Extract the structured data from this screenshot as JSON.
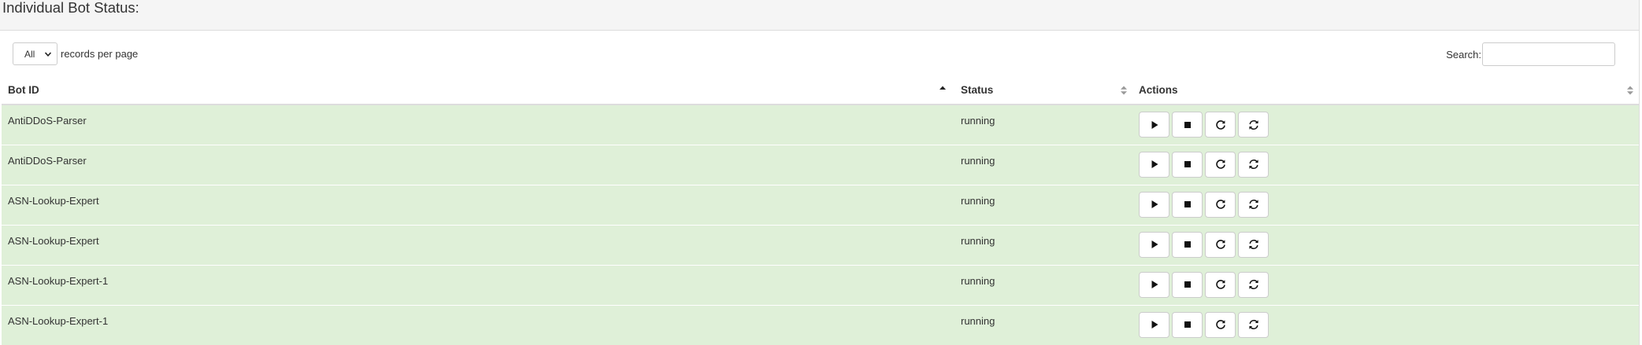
{
  "panel": {
    "title": "Individual Bot Status:"
  },
  "controls": {
    "length_value": "All",
    "length_label": "records per page",
    "search_label": "Search:",
    "search_value": ""
  },
  "table": {
    "columns": [
      "Bot ID",
      "Status",
      "Actions"
    ],
    "sorted_column": "Bot ID",
    "sort_direction": "ascending",
    "row_color": "#dff0d8",
    "rows": [
      {
        "bot_id": "AntiDDoS-Parser",
        "status": "running"
      },
      {
        "bot_id": "AntiDDoS-Parser",
        "status": "running"
      },
      {
        "bot_id": "ASN-Lookup-Expert",
        "status": "running"
      },
      {
        "bot_id": "ASN-Lookup-Expert",
        "status": "running"
      },
      {
        "bot_id": "ASN-Lookup-Expert-1",
        "status": "running"
      },
      {
        "bot_id": "ASN-Lookup-Expert-1",
        "status": "running"
      }
    ],
    "action_icons": [
      "play-icon",
      "stop-icon",
      "restart-icon",
      "reload-icon"
    ]
  }
}
